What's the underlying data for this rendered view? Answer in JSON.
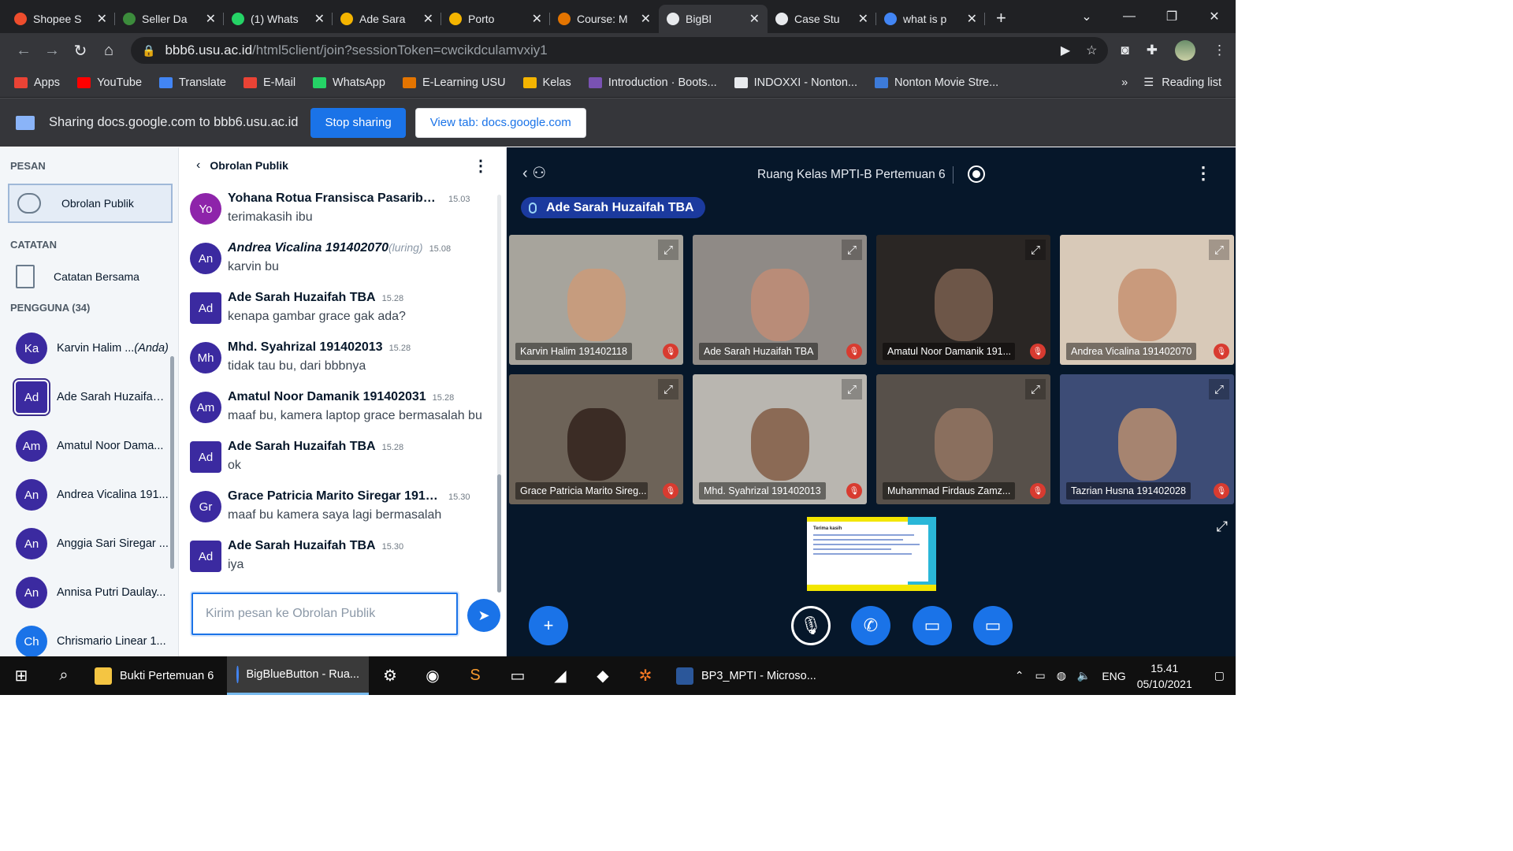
{
  "browser": {
    "tabs": [
      {
        "title": "Shopee S",
        "color": "#ee4d2d",
        "glyph": "S"
      },
      {
        "title": "Seller Da",
        "color": "#3c8c3c",
        "glyph": "●"
      },
      {
        "title": "(1) Whats",
        "color": "#25d366",
        "glyph": "✆"
      },
      {
        "title": "Ade Sara",
        "color": "#f4b400",
        "glyph": "▲"
      },
      {
        "title": "Porto",
        "color": "#f4b400",
        "glyph": "▬"
      },
      {
        "title": "Course: M",
        "color": "#e37400",
        "glyph": "in"
      },
      {
        "title": "BigBl",
        "color": "#e8eaed",
        "glyph": "●"
      },
      {
        "title": "Case Stu",
        "color": "#e8eaed",
        "glyph": "●"
      },
      {
        "title": "what is p",
        "color": "#4285f4",
        "glyph": "G"
      }
    ],
    "url_host": "bbb6.usu.ac.id",
    "url_path": "/html5client/join?sessionToken=cwcikdculamvxiy1",
    "bookmarks": [
      {
        "label": "Apps",
        "icon": "apps-icon",
        "color": "#ea4335"
      },
      {
        "label": "YouTube",
        "icon": "youtube-icon",
        "color": "#ff0000"
      },
      {
        "label": "Translate",
        "icon": "translate-icon",
        "color": "#4285f4"
      },
      {
        "label": "E-Mail",
        "icon": "gmail-icon",
        "color": "#ea4335"
      },
      {
        "label": "WhatsApp",
        "icon": "whatsapp-icon",
        "color": "#25d366"
      },
      {
        "label": "E-Learning USU",
        "icon": "elearning-icon",
        "color": "#e37400"
      },
      {
        "label": "Kelas",
        "icon": "kelas-icon",
        "color": "#f4b400"
      },
      {
        "label": "Introduction · Boots...",
        "icon": "bootstrap-icon",
        "color": "#7952b3"
      },
      {
        "label": "INDOXXI - Nonton...",
        "icon": "indoxxi-icon",
        "color": "#e8eaed"
      },
      {
        "label": "Nonton Movie Stre...",
        "icon": "movie-icon",
        "color": "#3d7bd9"
      }
    ],
    "more_bookmarks": "»",
    "reading_list": "Reading list"
  },
  "sharing": {
    "text": "Sharing docs.google.com to bbb6.usu.ac.id",
    "stop_label": "Stop sharing",
    "view_label": "View tab: docs.google.com"
  },
  "userlist": {
    "messages_header": "PESAN",
    "public_chat": "Obrolan Publik",
    "notes_header": "CATATAN",
    "shared_notes": "Catatan Bersama",
    "users_header": "PENGGUNA (34)",
    "users": [
      {
        "initials": "Ka",
        "name": "Karvin Halim ...",
        "suffix": "(Anda)",
        "color": "#3b2aa0",
        "badge": "muted"
      },
      {
        "initials": "Ad",
        "name": "Ade Sarah Huzaifah ...",
        "suffix": "",
        "color": "#3b2aa0",
        "badge": "talking"
      },
      {
        "initials": "Am",
        "name": "Amatul Noor Dama...",
        "suffix": "",
        "color": "#3b2aa0",
        "badge": "muted"
      },
      {
        "initials": "An",
        "name": "Andrea Vicalina 191...",
        "suffix": "",
        "color": "#3b2aa0",
        "badge": "muted"
      },
      {
        "initials": "An",
        "name": "Anggia Sari Siregar ...",
        "suffix": "",
        "color": "#3b2aa0",
        "badge": "listen"
      },
      {
        "initials": "An",
        "name": "Annisa Putri Daulay...",
        "suffix": "",
        "color": "#3b2aa0",
        "badge": "listen"
      },
      {
        "initials": "Ch",
        "name": "Chrismario Linear 1...",
        "suffix": "",
        "color": "#1a73e8",
        "badge": "none"
      }
    ]
  },
  "chat": {
    "title": "Obrolan Publik",
    "messages": [
      {
        "initials": "Yo",
        "color": "#8e24aa",
        "name": "Yohana Rotua Fransisca Pasaribu 1...",
        "luring": "",
        "time": "15.03",
        "text": "terimakasih ibu",
        "italic": false
      },
      {
        "initials": "An",
        "color": "#3b2aa0",
        "name": "Andrea Vicalina 191402070",
        "luring": "(luring)",
        "time": "15.08",
        "text": "karvin bu",
        "italic": true
      },
      {
        "initials": "Ad",
        "color": "#3b2aa0",
        "name": "Ade Sarah Huzaifah TBA",
        "luring": "",
        "time": "15.28",
        "text": "kenapa gambar grace gak ada?",
        "italic": false
      },
      {
        "initials": "Mh",
        "color": "#3b2aa0",
        "name": "Mhd. Syahrizal 191402013",
        "luring": "",
        "time": "15.28",
        "text": "tidak tau bu, dari bbbnya",
        "italic": false
      },
      {
        "initials": "Am",
        "color": "#3b2aa0",
        "name": "Amatul Noor Damanik 191402031",
        "luring": "",
        "time": "15.28",
        "text": "maaf bu, kamera laptop grace bermasalah bu",
        "italic": false
      },
      {
        "initials": "Ad",
        "color": "#3b2aa0",
        "name": "Ade Sarah Huzaifah TBA",
        "luring": "",
        "time": "15.28",
        "text": "ok",
        "italic": false
      },
      {
        "initials": "Gr",
        "color": "#3b2aa0",
        "name": "Grace Patricia Marito Siregar 19140...",
        "luring": "",
        "time": "15.30",
        "text": "maaf bu kamera saya lagi bermasalah",
        "italic": false
      },
      {
        "initials": "Ad",
        "color": "#3b2aa0",
        "name": "Ade Sarah Huzaifah TBA",
        "luring": "",
        "time": "15.30",
        "text": "iya",
        "italic": false
      }
    ],
    "input_placeholder": "Kirim pesan ke Obrolan Publik"
  },
  "stage": {
    "room_title": "Ruang Kelas MPTI-B Pertemuan 6",
    "talking": "Ade Sarah Huzaifah TBA",
    "videos": [
      {
        "name": "Karvin Halim 191402118",
        "bg": "#a7a49c",
        "face": "#c69c7e"
      },
      {
        "name": "Ade Sarah Huzaifah TBA",
        "bg": "#8f8a86",
        "face": "#b98c78"
      },
      {
        "name": "Amatul Noor Damanik 191...",
        "bg": "#2a2624",
        "face": "#6d5648"
      },
      {
        "name": "Andrea Vicalina 191402070",
        "bg": "#d8c9b8",
        "face": "#c99a7c"
      },
      {
        "name": "Grace Patricia Marito Sireg...",
        "bg": "#6d6358",
        "face": "#3b2c25"
      },
      {
        "name": "Mhd. Syahrizal 191402013",
        "bg": "#b9b6b0",
        "face": "#8b6a55"
      },
      {
        "name": "Muhammad Firdaus Zamz...",
        "bg": "#57504a",
        "face": "#8a6f5e"
      },
      {
        "name": "Tazrian Husna 191402028",
        "bg": "#3d4c76",
        "face": "#a68470"
      }
    ],
    "slide_title": "Terima kasih"
  },
  "taskbar": {
    "apps": [
      {
        "label": "Bukti Pertemuan 6",
        "icon": "folder-icon",
        "color": "#f4c542",
        "active": false
      },
      {
        "label": "BigBlueButton - Rua...",
        "icon": "chrome-icon",
        "color": "#4285f4",
        "active": true
      }
    ],
    "word_label": "BP3_MPTI - Microso...",
    "lang": "ENG",
    "time": "15.41",
    "date": "05/10/2021"
  }
}
